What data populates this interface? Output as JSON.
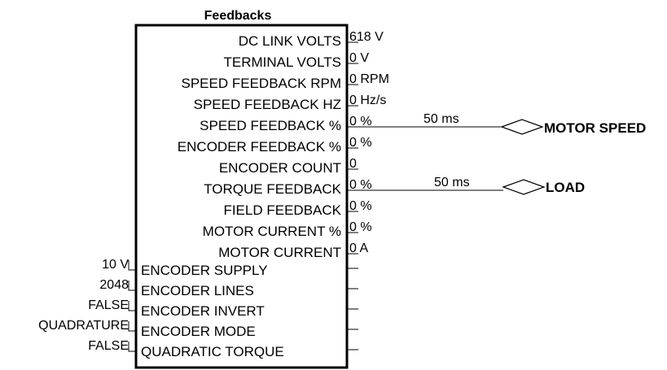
{
  "block": {
    "title": "Feedbacks",
    "outputs": [
      {
        "label": "DC LINK VOLTS",
        "value": "618 V"
      },
      {
        "label": "TERMINAL VOLTS",
        "value": "0 V"
      },
      {
        "label": "SPEED FEEDBACK RPM",
        "value": "0 RPM"
      },
      {
        "label": "SPEED FEEDBACK HZ",
        "value": "0 Hz/s"
      },
      {
        "label": "SPEED FEEDBACK %",
        "value": "0 %"
      },
      {
        "label": "ENCODER FEEDBACK %",
        "value": "0 %"
      },
      {
        "label": "ENCODER COUNT",
        "value": "0"
      },
      {
        "label": "TORQUE FEEDBACK",
        "value": "0 %"
      },
      {
        "label": "FIELD FEEDBACK",
        "value": "0 %"
      },
      {
        "label": "MOTOR CURRENT %",
        "value": "0 %"
      },
      {
        "label": "MOTOR CURRENT",
        "value": "0 A"
      }
    ],
    "inputs": [
      {
        "label": "ENCODER SUPPLY",
        "value": "10 V"
      },
      {
        "label": "ENCODER LINES",
        "value": "2048"
      },
      {
        "label": "ENCODER INVERT",
        "value": "FALSE"
      },
      {
        "label": "ENCODER MODE",
        "value": "QUADRATURE"
      },
      {
        "label": "QUADRATIC TORQUE",
        "value": "FALSE"
      }
    ]
  },
  "connections": [
    {
      "time": "50 ms",
      "tag": "MOTOR SPEED"
    },
    {
      "time": "50 ms",
      "tag": "LOAD"
    }
  ]
}
